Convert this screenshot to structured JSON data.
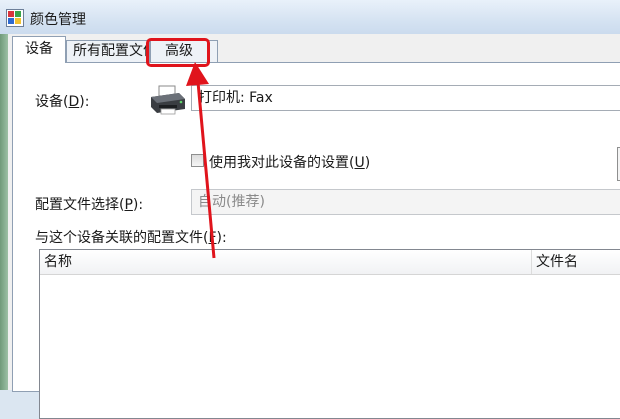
{
  "window": {
    "title": "颜色管理"
  },
  "tabs": [
    {
      "label": "设备",
      "active": true
    },
    {
      "label": "所有配置文件",
      "active": false
    },
    {
      "label": "高级",
      "active": false
    }
  ],
  "device": {
    "label": "设备(",
    "accelerator": "D",
    "label_end": "):",
    "value": "打印机: Fax",
    "icon": "printer-icon"
  },
  "use_settings": {
    "label": "使用我对此设备的设置(",
    "accelerator": "U",
    "label_end": ")",
    "checked": false
  },
  "profile_selection": {
    "label": "配置文件选择(",
    "accelerator": "P",
    "label_end": "):",
    "value": "自动(推荐)"
  },
  "associated_profiles": {
    "label": "与这个设备关联的配置文件(",
    "accelerator": "F",
    "label_end": "):",
    "columns": [
      "名称",
      "文件名"
    ]
  },
  "annotation": {
    "color": "#e0141c"
  }
}
